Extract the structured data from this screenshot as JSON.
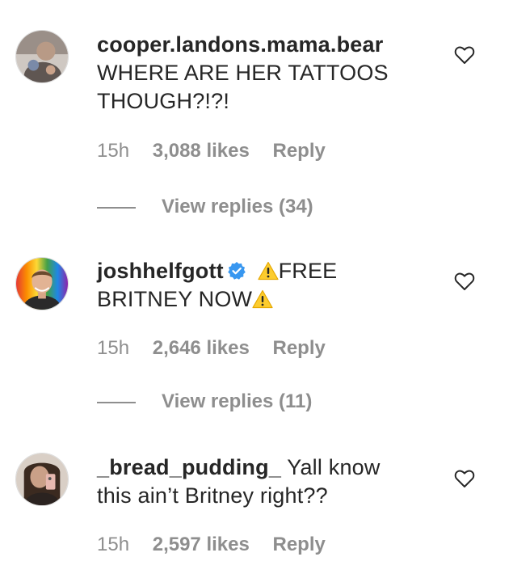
{
  "comments": [
    {
      "username": "cooper.landons.mama.bear",
      "verified": false,
      "text_line1": "WHERE ARE HER TATTOOS",
      "text_line2": "THOUGH?!?!",
      "time": "15h",
      "likes": "3,088 likes",
      "reply_label": "Reply",
      "view_replies": "View replies (34)"
    },
    {
      "username": "joshhelfgott",
      "verified": true,
      "text_inline": "FREE",
      "text_line2": "BRITNEY NOW",
      "time": "15h",
      "likes": "2,646 likes",
      "reply_label": "Reply",
      "view_replies": "View replies (11)"
    },
    {
      "username": "_bread_pudding_",
      "verified": false,
      "text_inline": "Yall know",
      "text_line2": "this ain’t Britney right??",
      "time": "15h",
      "likes": "2,597 likes",
      "reply_label": "Reply"
    }
  ],
  "icons": {
    "like": "heart-outline-icon",
    "verified": "verified-badge-icon",
    "warning": "warning-emoji-icon"
  },
  "colors": {
    "text": "#262626",
    "secondary": "#8e8e8e",
    "verified": "#3897f0",
    "warning": "#fccc2e"
  }
}
